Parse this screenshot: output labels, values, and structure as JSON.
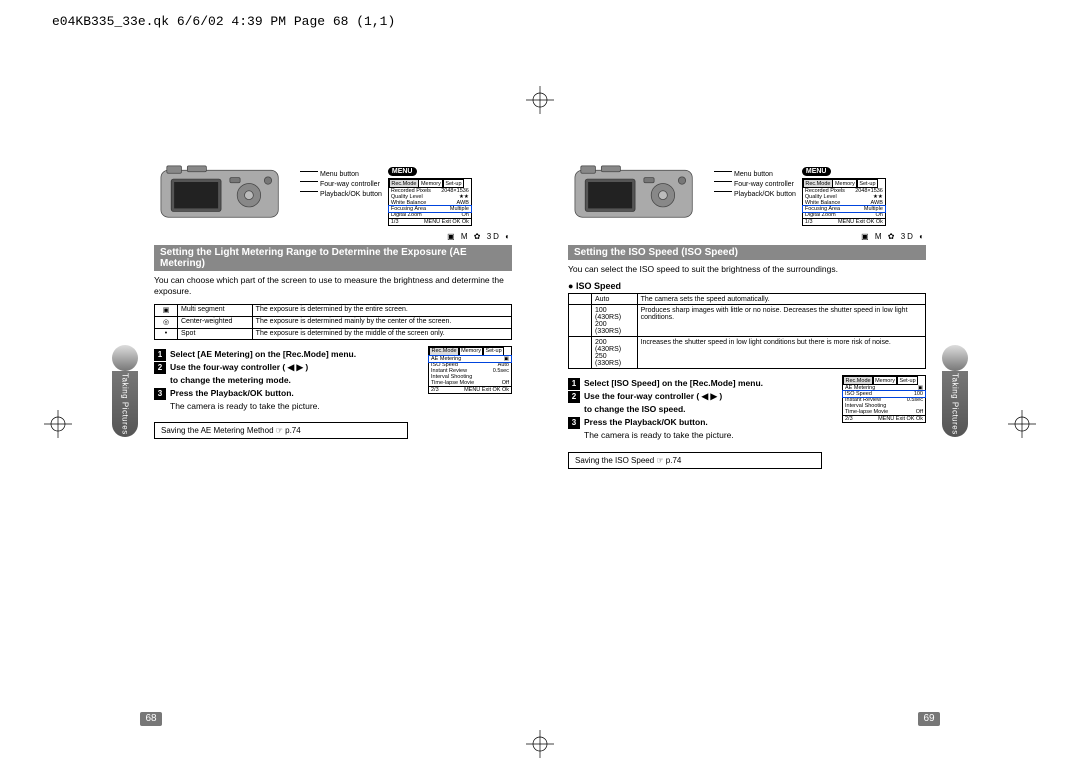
{
  "slug": "e04KB335_33e.qk  6/6/02 4:39 PM  Page 68 (1,1)",
  "tab_label": "Taking Pictures",
  "page_numbers": {
    "left": "68",
    "right": "69"
  },
  "camera_labels": {
    "menu": "Menu button",
    "fourway": "Four-way controller",
    "playback": "Playback/OK button"
  },
  "menu_badge": "MENU",
  "lcd1": {
    "tabs": [
      "Rec.Mode",
      "Memory",
      "Set-up"
    ],
    "rows": [
      [
        "Recorded Pixels",
        "2048×1536"
      ],
      [
        "Quality Level",
        "★★"
      ],
      [
        "White Balance",
        "AWB"
      ],
      [
        "Focusing Area",
        "Multiple"
      ],
      [
        "Digital Zoom",
        "On"
      ]
    ],
    "hl_row": 3,
    "page": "1/3",
    "foot": "MENU Exit   OK Ok"
  },
  "mode_icons": "▣ M ✿ 3D ◐",
  "left": {
    "title": "Setting the Light Metering Range to Determine the Exposure (AE Metering)",
    "intro": "You can choose which part of the screen to use to measure the brightness and determine the exposure.",
    "table": [
      [
        "▣",
        "Multi segment",
        "The exposure is determined by the entire screen."
      ],
      [
        "◎",
        "Center-weighted",
        "The exposure is determined mainly by the center of the screen."
      ],
      [
        "•",
        "Spot",
        "The exposure is determined by the middle of the screen only."
      ]
    ],
    "step1": "Select [AE Metering] on the [Rec.Mode] menu.",
    "step2a": "Use the four-way controller ( ◀ ▶ )",
    "step2b": "to change the metering mode.",
    "step3": "Press the Playback/OK button.",
    "after3": "The camera is ready to take the picture.",
    "lcd2": {
      "tabs": [
        "Rec.Mode",
        "Memory",
        "Set-up"
      ],
      "rows": [
        [
          "AE Metering",
          "▣"
        ],
        [
          "ISO Speed",
          "Auto"
        ],
        [
          "Instant Review",
          "0.5sec"
        ],
        [
          "Interval Shooting",
          ""
        ],
        [
          "Time-lapse Movie",
          "Off"
        ]
      ],
      "hl_row": 0,
      "page": "2/3",
      "foot": "MENU Exit   OK Ok"
    },
    "crossref": "Saving the AE Metering Method ☞ p.74"
  },
  "right": {
    "title": "Setting the ISO Speed (ISO Speed)",
    "intro": "You can select the ISO speed to suit the brightness of the surroundings.",
    "subhead": "ISO Speed",
    "table": [
      [
        "",
        "Auto",
        "The camera sets the speed automatically."
      ],
      [
        "",
        "100 (430RS)\n200 (330RS)",
        "Produces sharp images with little or no noise. Decreases the shutter speed in low light conditions."
      ],
      [
        "",
        "200 (430RS)\n250 (330RS)",
        "Increases the shutter speed in low light conditions but there is more risk of noise."
      ]
    ],
    "step1": "Select [ISO Speed] on the [Rec.Mode] menu.",
    "step2a": "Use the four-way controller ( ◀ ▶ )",
    "step2b": "to change the ISO speed.",
    "step3": "Press the Playback/OK button.",
    "after3": "The camera is ready to take the picture.",
    "lcd2": {
      "tabs": [
        "Rec.Mode",
        "Memory",
        "Set-up"
      ],
      "rows": [
        [
          "AE Metering",
          "▣"
        ],
        [
          "ISO Speed",
          "100"
        ],
        [
          "Instant Review",
          "0.5sec"
        ],
        [
          "Interval Shooting",
          ""
        ],
        [
          "Time-lapse Movie",
          "Off"
        ]
      ],
      "hl_row": 1,
      "page": "2/3",
      "foot": "MENU Exit   OK Ok"
    },
    "crossref": "Saving the ISO Speed ☞ p.74"
  }
}
